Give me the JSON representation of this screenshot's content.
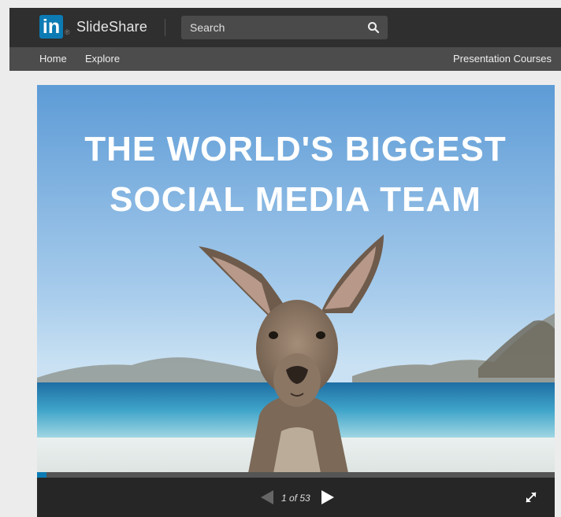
{
  "header": {
    "logo_text": "in",
    "logo_reg": "®",
    "brand": "SlideShare",
    "search_placeholder": "Search",
    "icons": {
      "search": "search-icon"
    }
  },
  "nav": {
    "home": "Home",
    "explore": "Explore",
    "presentation_courses": "Presentation Courses"
  },
  "slide": {
    "title_line1": "THE WORLD'S BIGGEST",
    "title_line2": "SOCIAL MEDIA TEAM"
  },
  "player": {
    "page_indicator": "1 of 53",
    "progress_fraction": 0.019,
    "icons": {
      "prev": "previous-arrow-icon",
      "next": "next-arrow-icon",
      "fullscreen": "fullscreen-icon"
    }
  },
  "colors": {
    "brand_blue": "#0c7bb3",
    "header_bg": "#2f2f2f",
    "nav_bg": "#4c4c4c",
    "player_bg": "#262626"
  }
}
